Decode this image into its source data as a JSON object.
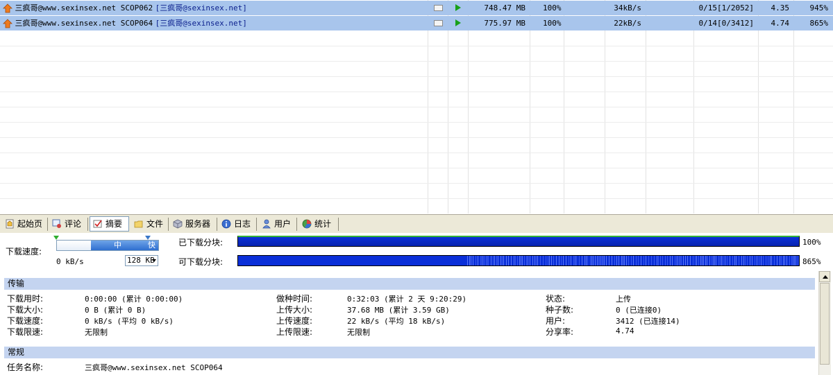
{
  "tasks": [
    {
      "name": "三疯哥@www.sexinsex.net SCOP062",
      "uploader": "[三疯哥@sexinsex.net]",
      "size": "748.47 MB",
      "progress": "100%",
      "upload_speed": "34kB/s",
      "peers": "0/15[1/2052]",
      "ratio": "4.35",
      "availability": "945%"
    },
    {
      "name": "三疯哥@www.sexinsex.net SCOP064",
      "uploader": "[三疯哥@sexinsex.net]",
      "size": "775.97 MB",
      "progress": "100%",
      "upload_speed": "22kB/s",
      "peers": "0/14[0/3412]",
      "ratio": "4.74",
      "availability": "865%"
    }
  ],
  "tabs": [
    {
      "label": "起始页",
      "icon": "home-page-icon"
    },
    {
      "label": "评论",
      "icon": "comment-icon"
    },
    {
      "label": "摘要",
      "icon": "summary-check-icon",
      "active": true
    },
    {
      "label": "文件",
      "icon": "folder-icon"
    },
    {
      "label": "服务器",
      "icon": "server-cube-icon"
    },
    {
      "label": "日志",
      "icon": "info-log-icon"
    },
    {
      "label": "用户",
      "icon": "user-icon"
    },
    {
      "label": "统计",
      "icon": "statistics-icon"
    }
  ],
  "speed": {
    "label": "下载速度:",
    "mid": "中",
    "fast": "快",
    "current": "0 kB/s",
    "block_size": "128 KB"
  },
  "blocks": {
    "downloaded_label": "已下载分块:",
    "downloaded_pct": "100%",
    "available_label": "可下载分块:",
    "available_pct": "865%"
  },
  "transfer": {
    "title": "传输",
    "col1": [
      {
        "label": "下载用时:",
        "value": "0:00:00 (累计 0:00:00)"
      },
      {
        "label": "下载大小:",
        "value": "0 B (累计 0 B)"
      },
      {
        "label": "下载速度:",
        "value": "0 kB/s (平均 0 kB/s)"
      },
      {
        "label": "下载限速:",
        "value": "无限制"
      }
    ],
    "col2": [
      {
        "label": "做种时间:",
        "value": "0:32:03 (累计 2 天 9:20:29)"
      },
      {
        "label": "上传大小:",
        "value": "37.68 MB (累计 3.59 GB)"
      },
      {
        "label": "上传速度:",
        "value": "22 kB/s (平均 18 kB/s)"
      },
      {
        "label": "上传限速:",
        "value": "无限制"
      }
    ],
    "col3": [
      {
        "label": "状态:",
        "value": "上传"
      },
      {
        "label": "种子数:",
        "value": "0 (已连接0)"
      },
      {
        "label": "用户:",
        "value": "3412 (已连接14)"
      },
      {
        "label": "分享率:",
        "value": "4.74"
      }
    ]
  },
  "general": {
    "title": "常规",
    "task_name_label": "任务名称:",
    "task_name_value": "三疯哥@www.sexinsex.net SCOP064"
  },
  "colors": {
    "selected_row": "#a8c5ec",
    "block_bar": "#0a2fd8",
    "section_header": "#c4d4f0",
    "tab_bar": "#ece9d8"
  }
}
